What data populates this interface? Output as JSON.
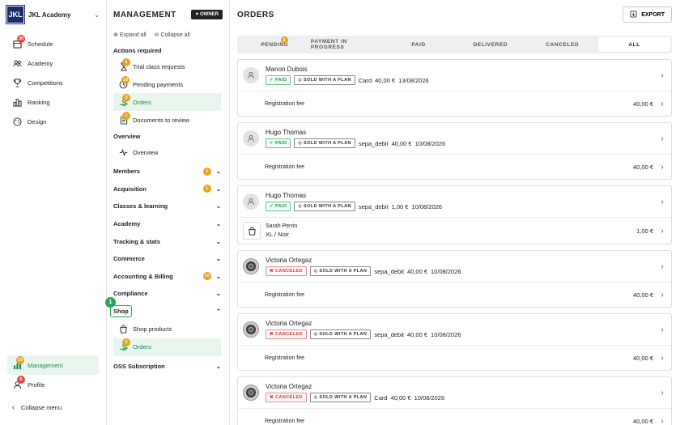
{
  "org": {
    "logo_text": "JKL",
    "name": "JKL Academy"
  },
  "rail": {
    "items": [
      {
        "label": "Schedule",
        "badge": "30"
      },
      {
        "label": "Academy",
        "badge": ""
      },
      {
        "label": "Competitions",
        "badge": ""
      },
      {
        "label": "Ranking",
        "badge": ""
      },
      {
        "label": "Design",
        "badge": ""
      }
    ],
    "management": {
      "label": "Management",
      "badge": "13"
    },
    "profile": {
      "label": "Profile",
      "badge": "6"
    },
    "collapse_label": "Collapse menu"
  },
  "side": {
    "title": "MANAGEMENT",
    "owner_label": "OWNER",
    "expand_all": "Expand all",
    "collapse_all": "Collapse all",
    "actions_title": "Actions required",
    "actions": [
      {
        "label": "Trial class requests",
        "badge": "1"
      },
      {
        "label": "Pending payments",
        "badge": "10"
      },
      {
        "label": "Orders",
        "badge": "3"
      },
      {
        "label": "Documents to review",
        "badge": "1"
      }
    ],
    "overview_title": "Overview",
    "overview_item": "Overview",
    "groups": [
      {
        "label": "Members",
        "badge": "1"
      },
      {
        "label": "Acquisition",
        "badge": "1"
      },
      {
        "label": "Classes & learning",
        "badge": ""
      },
      {
        "label": "Academy",
        "badge": ""
      },
      {
        "label": "Tracking & stats",
        "badge": ""
      },
      {
        "label": "Commerce",
        "badge": ""
      },
      {
        "label": "Accounting & Billing",
        "badge": "10"
      },
      {
        "label": "Compliance",
        "badge": ""
      }
    ],
    "shop": {
      "label": "Shop",
      "step": "1",
      "products": "Shop products",
      "orders": "Orders",
      "orders_badge": "3"
    },
    "oss": "OSS Subscription"
  },
  "main": {
    "title": "ORDERS",
    "export_label": "EXPORT",
    "tabs": [
      {
        "label": "PENDING",
        "badge": "3"
      },
      {
        "label": "PAYMENT IN PROGRESS",
        "badge": ""
      },
      {
        "label": "PAID",
        "badge": ""
      },
      {
        "label": "DELIVERED",
        "badge": ""
      },
      {
        "label": "CANCELED",
        "badge": ""
      },
      {
        "label": "ALL",
        "badge": ""
      }
    ],
    "orders": [
      {
        "name": "Manon Dubois",
        "status": "PAID",
        "plan": "SOLD WITH A PLAN",
        "method": "Card",
        "amount": "40,00 €",
        "date": "13/08/2026",
        "line": "Registration fee",
        "line_price": "40,00 €",
        "avatar": "person"
      },
      {
        "name": "Hugo Thomas",
        "status": "PAID",
        "plan": "SOLD WITH A PLAN",
        "method": "sepa_debit",
        "amount": "40,00 €",
        "date": "10/08/2026",
        "line": "Registration fee",
        "line_price": "40,00 €",
        "avatar": "person"
      },
      {
        "name": "Hugo Thomas",
        "status": "PAID",
        "plan": "SOLD WITH A PLAN",
        "method": "sepa_debit",
        "amount": "1,00 €",
        "date": "10/08/2026",
        "line": "Sarah Perrin",
        "line_sub": "XL / Noir",
        "line_price": "1,00 €",
        "avatar": "person"
      },
      {
        "name": "Victoria Ortegaz",
        "status": "CANCELED",
        "plan": "SOLD WITH A PLAN",
        "method": "sepa_debit",
        "amount": "40,00 €",
        "date": "10/08/2026",
        "line": "Registration fee",
        "line_price": "40,00 €",
        "avatar": "photo"
      },
      {
        "name": "Victoria Ortegaz",
        "status": "CANCELED",
        "plan": "SOLD WITH A PLAN",
        "method": "sepa_debit",
        "amount": "40,00 €",
        "date": "10/08/2026",
        "line": "Registration fee",
        "line_price": "40,00 €",
        "avatar": "photo"
      },
      {
        "name": "Victoria Ortegaz",
        "status": "CANCELED",
        "plan": "SOLD WITH A PLAN",
        "method": "Card",
        "amount": "40,00 €",
        "date": "10/08/2026",
        "line": "Registration fee",
        "line_price": "40,00 €",
        "avatar": "photo"
      }
    ]
  },
  "colors": {
    "accent_green": "#2aa45c",
    "paid": "#1e9a55",
    "canceled": "#d23a3a",
    "badge_orange": "#e9a21a",
    "badge_red": "#e04a4a",
    "logo_navy": "#1b2a6b"
  }
}
